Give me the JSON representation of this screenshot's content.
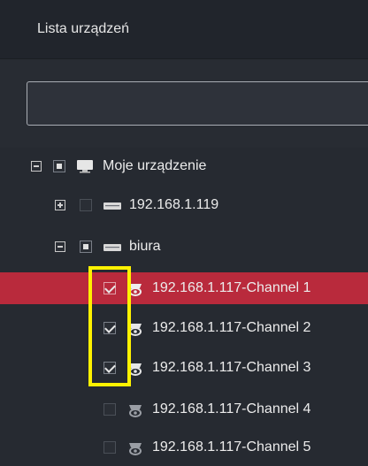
{
  "panel": {
    "title": "Lista urządzeń"
  },
  "search": {
    "value": "",
    "placeholder": ""
  },
  "tree": {
    "root": {
      "label": "Moje urządzenie",
      "expanded": true,
      "check_state": "partial",
      "icon": "monitor-icon"
    },
    "devices": [
      {
        "label": "192.168.1.119",
        "expanded": false,
        "check_state": "unchecked",
        "icon": "nvr-icon"
      },
      {
        "label": "biura",
        "expanded": true,
        "check_state": "partial",
        "icon": "nvr-icon"
      }
    ],
    "channels": [
      {
        "label": "192.168.1.117-Channel 1",
        "checked": true,
        "selected": true,
        "icon": "camera-icon"
      },
      {
        "label": "192.168.1.117-Channel 2",
        "checked": true,
        "selected": false,
        "icon": "camera-icon"
      },
      {
        "label": "192.168.1.117-Channel 3",
        "checked": true,
        "selected": false,
        "icon": "camera-icon"
      },
      {
        "label": "192.168.1.117-Channel 4",
        "checked": false,
        "selected": false,
        "icon": "camera-icon"
      },
      {
        "label": "192.168.1.117-Channel 5",
        "checked": false,
        "selected": false,
        "icon": "camera-icon"
      }
    ]
  },
  "colors": {
    "background": "#262a31",
    "selected_row": "#b92a3c",
    "annotation_highlight": "#fff200"
  }
}
